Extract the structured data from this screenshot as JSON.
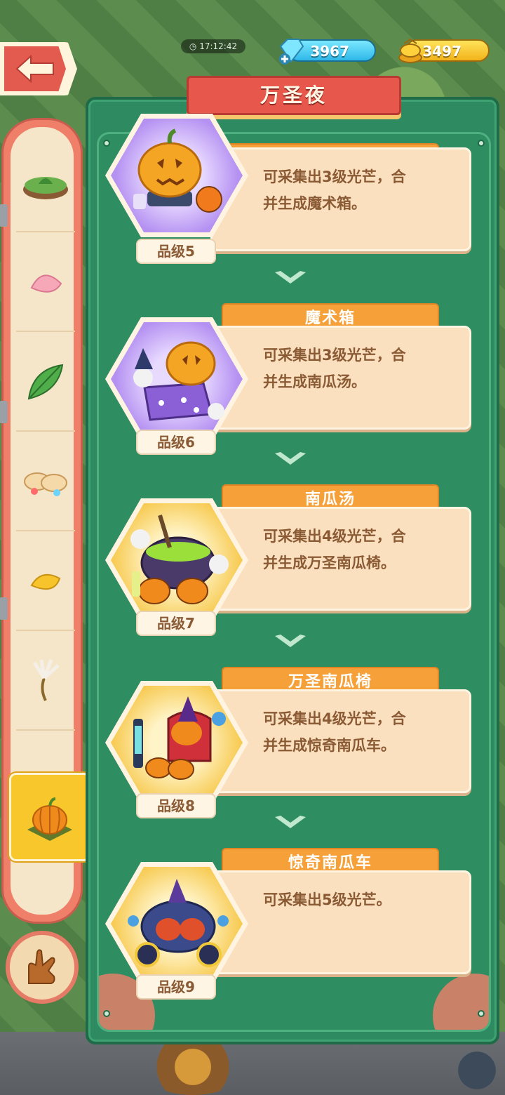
{
  "header": {
    "timer": "17:12:42",
    "gems": "3967",
    "gold": "3497",
    "title": "万圣夜"
  },
  "colors": {
    "panel": "#2e8a60",
    "ribbon": "#e8574b",
    "card": "#fbe0bf",
    "name_tab": "#f6a03a",
    "active_tab": "#f7c72b"
  },
  "sidebar": {
    "items": [
      {
        "icon": "grass-patch-icon"
      },
      {
        "icon": "pink-petal-icon"
      },
      {
        "icon": "green-leaf-icon"
      },
      {
        "icon": "candy-pile-icon"
      },
      {
        "icon": "yellow-petal-icon"
      },
      {
        "icon": "dandelion-icon"
      },
      {
        "icon": "pumpkin-icon",
        "active": true
      }
    ],
    "hand_icon": "glove-hand-icon"
  },
  "cards": [
    {
      "name": "",
      "level": "品级5",
      "line1": "可采集出3级光芒，合",
      "line2": "并生成魔术箱。",
      "bg": "purple",
      "icon": "pumpkin-lantern-icon"
    },
    {
      "name": "魔术箱",
      "level": "品级6",
      "line1": "可采集出3级光芒，合",
      "line2": "并生成南瓜汤。",
      "bg": "purple",
      "icon": "magic-box-icon"
    },
    {
      "name": "南瓜汤",
      "level": "品级7",
      "line1": "可采集出4级光芒，合",
      "line2": "并生成万圣南瓜椅。",
      "bg": "yellow",
      "icon": "pumpkin-soup-icon"
    },
    {
      "name": "万圣南瓜椅",
      "level": "品级8",
      "line1": "可采集出4级光芒，合",
      "line2": "并生成惊奇南瓜车。",
      "bg": "yellow",
      "icon": "pumpkin-chair-icon"
    },
    {
      "name": "惊奇南瓜车",
      "level": "品级9",
      "line1": "可采集出5级光芒。",
      "line2": "",
      "bg": "yellow",
      "icon": "pumpkin-carriage-icon"
    }
  ]
}
